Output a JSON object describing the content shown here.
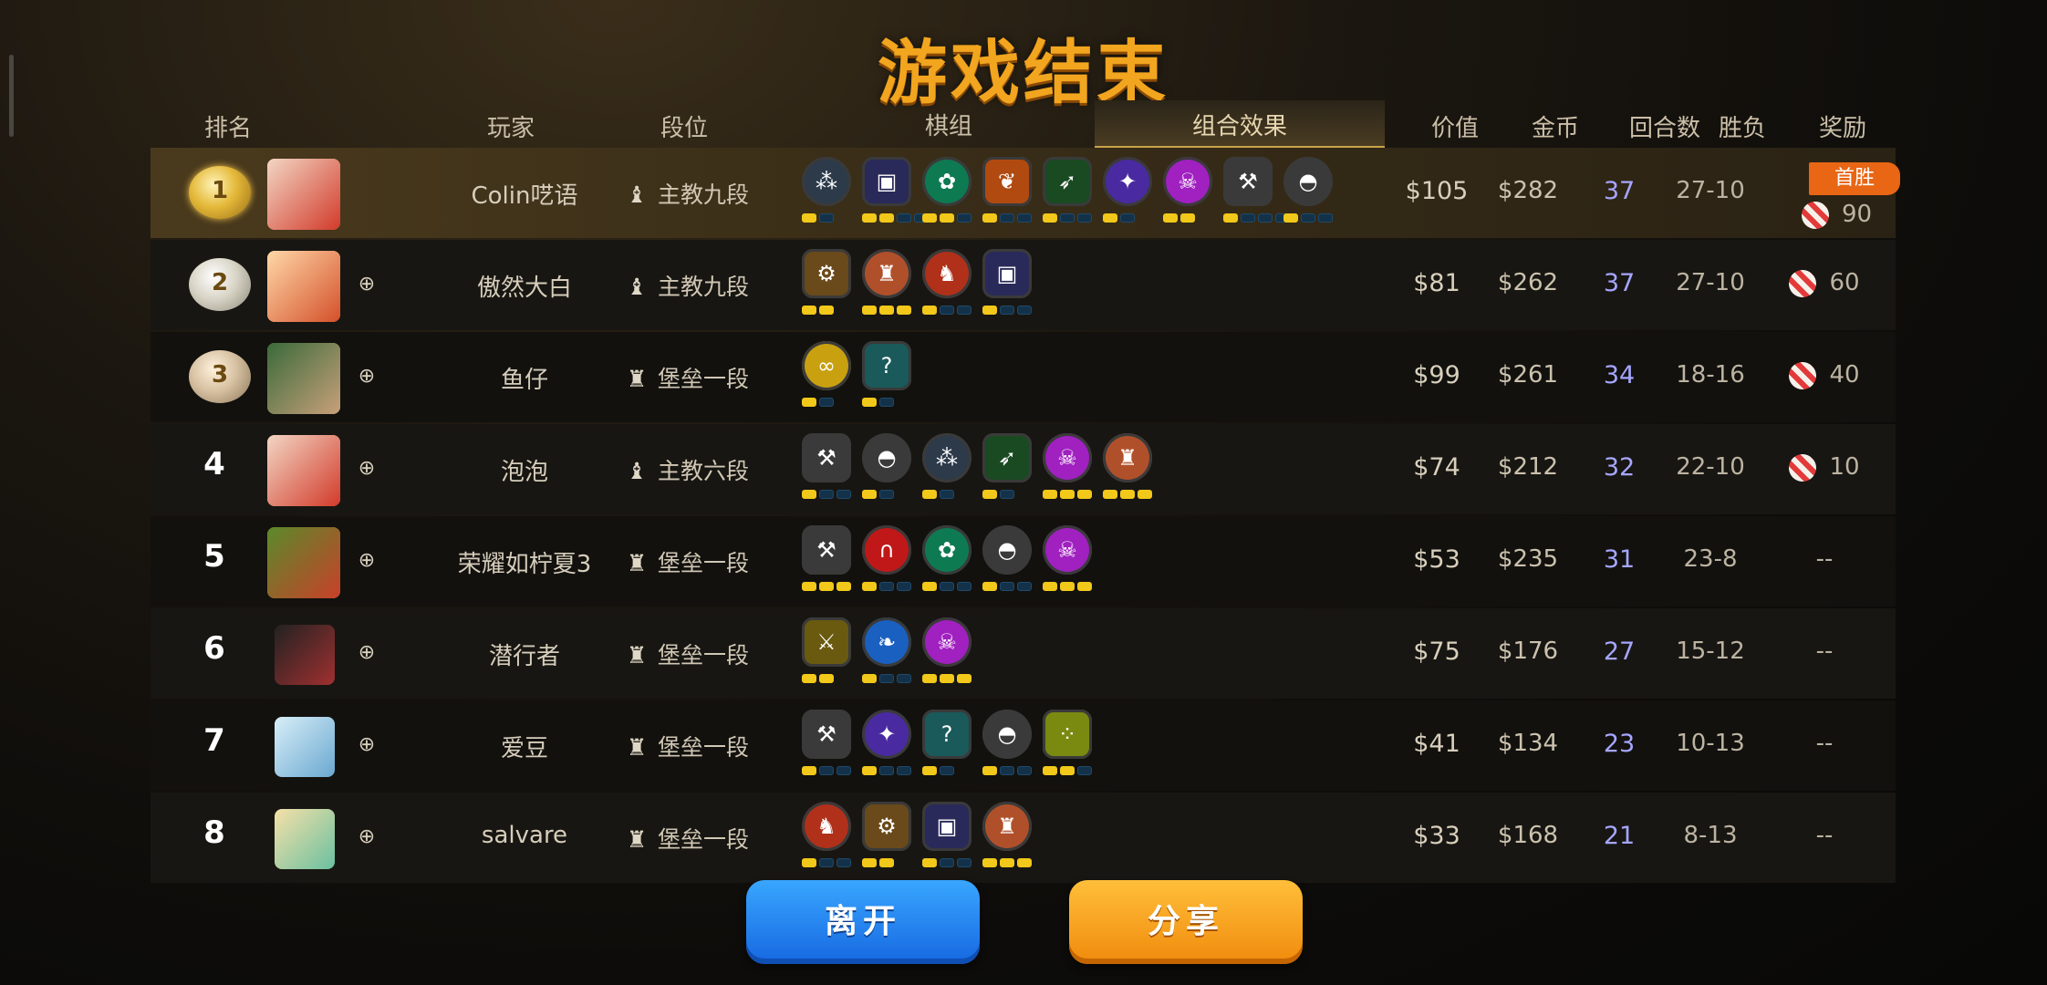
{
  "title": "游戏结束",
  "header": {
    "rank": "排名",
    "player": "玩家",
    "tier": "段位",
    "pieces": "棋组",
    "synergy": "组合效果",
    "value": "价值",
    "gold": "金币",
    "rounds": "回合数",
    "win_loss": "胜负",
    "reward": "奖励"
  },
  "rows": [
    {
      "rank": "1",
      "medal": "gold",
      "name": "Colin呓语",
      "tier": "主教九段",
      "tier_icon": "bishop-icon",
      "value": "$105",
      "gold": "$282",
      "rounds": "37",
      "wl": "27-10",
      "reward_badge": "首胜",
      "reward": "90",
      "has_add": false
    },
    {
      "rank": "2",
      "medal": "silver",
      "name": "傲然大白",
      "tier": "主教九段",
      "tier_icon": "bishop-icon",
      "value": "$81",
      "gold": "$262",
      "rounds": "37",
      "wl": "27-10",
      "reward": "60",
      "has_add": true
    },
    {
      "rank": "3",
      "medal": "bronze",
      "name": "鱼仔",
      "tier": "堡垒一段",
      "tier_icon": "rook-icon",
      "value": "$99",
      "gold": "$261",
      "rounds": "34",
      "wl": "18-16",
      "reward": "40",
      "has_add": true
    },
    {
      "rank": "4",
      "name": "泡泡",
      "tier": "主教六段",
      "tier_icon": "bishop-icon",
      "value": "$74",
      "gold": "$212",
      "rounds": "32",
      "wl": "22-10",
      "reward": "10",
      "has_add": true
    },
    {
      "rank": "5",
      "name": "荣耀如柠夏3",
      "tier": "堡垒一段",
      "tier_icon": "rook-icon",
      "value": "$53",
      "gold": "$235",
      "rounds": "31",
      "wl": "23-8",
      "reward": "--",
      "has_add": true
    },
    {
      "rank": "6",
      "name": "潜行者",
      "tier": "堡垒一段",
      "tier_icon": "rook-icon",
      "value": "$75",
      "gold": "$176",
      "rounds": "27",
      "wl": "15-12",
      "reward": "--",
      "has_add": true
    },
    {
      "rank": "7",
      "name": "爱豆",
      "tier": "堡垒一段",
      "tier_icon": "rook-icon",
      "value": "$41",
      "gold": "$134",
      "rounds": "23",
      "wl": "10-13",
      "reward": "--",
      "has_add": true
    },
    {
      "rank": "8",
      "name": "salvare",
      "tier": "堡垒一段",
      "tier_icon": "rook-icon",
      "value": "$33",
      "gold": "$168",
      "rounds": "21",
      "wl": "8-13",
      "reward": "--",
      "has_add": true
    }
  ],
  "synergies": [
    [
      {
        "icon": "footprint-icon",
        "color": "#2c3a4a",
        "bars": [
          1,
          0
        ]
      },
      {
        "icon": "mech-icon",
        "color": "#2a2a5a",
        "bars": [
          1,
          1,
          0,
          0
        ]
      },
      {
        "icon": "paw-icon",
        "color": "#0e7a52",
        "bars": [
          1,
          1,
          0
        ]
      },
      {
        "icon": "leaf-icon",
        "color": "#b04a10",
        "bars": [
          1,
          0,
          0
        ]
      },
      {
        "icon": "bow-icon",
        "color": "#1a4a22",
        "bars": [
          1,
          0,
          0
        ]
      },
      {
        "icon": "fish-icon",
        "color": "#4a2aa0",
        "bars": [
          1,
          0
        ]
      },
      {
        "icon": "demon-icon",
        "color": "#a020c0",
        "bars": [
          1,
          1
        ]
      },
      {
        "icon": "axe-icon",
        "color": "#3a3a3a",
        "bars": [
          1,
          0,
          0,
          0
        ]
      },
      {
        "icon": "helmet-icon",
        "color": "#3a3a3a",
        "bars": [
          1,
          0,
          0
        ]
      }
    ],
    [
      {
        "icon": "gear-icon",
        "color": "#6a4a1a",
        "bars": [
          1,
          1
        ]
      },
      {
        "icon": "viking-icon",
        "color": "#b0502a",
        "bars": [
          1,
          1,
          1
        ]
      },
      {
        "icon": "orc-icon",
        "color": "#b0301a",
        "bars": [
          1,
          0,
          0
        ]
      },
      {
        "icon": "mech-icon",
        "color": "#2a2a5a",
        "bars": [
          1,
          0,
          0
        ]
      }
    ],
    [
      {
        "icon": "knot-icon",
        "color": "#c8a010",
        "bars": [
          1,
          0
        ]
      },
      {
        "icon": "hook-icon",
        "color": "#1a5a5a",
        "bars": [
          1,
          0
        ]
      }
    ],
    [
      {
        "icon": "axe-icon",
        "color": "#3a3a3a",
        "bars": [
          1,
          0,
          0
        ]
      },
      {
        "icon": "helmet-icon",
        "color": "#3a3a3a",
        "bars": [
          1,
          0
        ]
      },
      {
        "icon": "footprint-icon",
        "color": "#2c3a4a",
        "bars": [
          1,
          0
        ]
      },
      {
        "icon": "bow-icon",
        "color": "#1a4a22",
        "bars": [
          1,
          0
        ]
      },
      {
        "icon": "demon-icon",
        "color": "#a020c0",
        "bars": [
          1,
          1,
          1
        ]
      },
      {
        "icon": "viking-icon",
        "color": "#b0502a",
        "bars": [
          1,
          1,
          1
        ]
      }
    ],
    [
      {
        "icon": "axe-icon",
        "color": "#3a3a3a",
        "bars": [
          1,
          1,
          1
        ]
      },
      {
        "icon": "arch-icon",
        "color": "#c01818",
        "bars": [
          1,
          0,
          0
        ]
      },
      {
        "icon": "paw-icon",
        "color": "#0e7a52",
        "bars": [
          1,
          0,
          0
        ]
      },
      {
        "icon": "helmet-icon",
        "color": "#3a3a3a",
        "bars": [
          1,
          0,
          0
        ]
      },
      {
        "icon": "demon-icon",
        "color": "#a020c0",
        "bars": [
          1,
          1,
          1
        ]
      }
    ],
    [
      {
        "icon": "dagger-icon",
        "color": "#6a5a10",
        "bars": [
          1,
          1
        ]
      },
      {
        "icon": "feather-icon",
        "color": "#1a60c0",
        "bars": [
          1,
          0,
          0
        ]
      },
      {
        "icon": "demon-icon",
        "color": "#a020c0",
        "bars": [
          1,
          1,
          1
        ]
      }
    ],
    [
      {
        "icon": "axe-icon",
        "color": "#3a3a3a",
        "bars": [
          1,
          0,
          0
        ]
      },
      {
        "icon": "fish-icon",
        "color": "#4a2aa0",
        "bars": [
          1,
          0,
          0
        ]
      },
      {
        "icon": "hook-icon",
        "color": "#1a5a5a",
        "bars": [
          1,
          0
        ]
      },
      {
        "icon": "helmet-icon",
        "color": "#3a3a3a",
        "bars": [
          1,
          0,
          0
        ]
      },
      {
        "icon": "cells-icon",
        "color": "#7a8a10",
        "bars": [
          1,
          1,
          0
        ]
      }
    ],
    [
      {
        "icon": "orc-icon",
        "color": "#b0301a",
        "bars": [
          1,
          0,
          0
        ]
      },
      {
        "icon": "gear-icon",
        "color": "#6a4a1a",
        "bars": [
          1,
          1
        ]
      },
      {
        "icon": "mech-icon",
        "color": "#2a2a5a",
        "bars": [
          1,
          0,
          0
        ]
      },
      {
        "icon": "viking-icon",
        "color": "#b0502a",
        "bars": [
          1,
          1,
          1
        ]
      }
    ]
  ],
  "buttons": {
    "leave": "离开",
    "share": "分享"
  }
}
